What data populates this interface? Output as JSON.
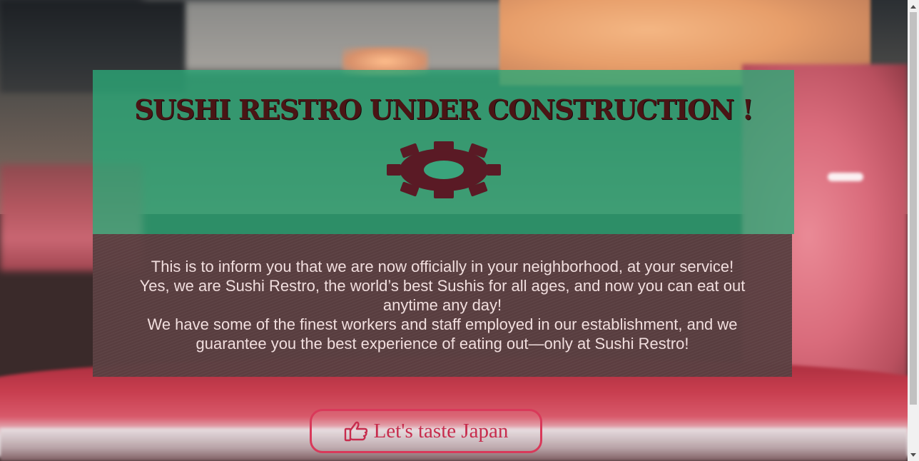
{
  "hero": {
    "title": "SUSHI RESTRO UNDER CONSTRUCTION !"
  },
  "info": {
    "paragraph_1": "This is to inform you that we are now officially in your neighborhood, at your service!",
    "paragraph_2": "Yes, we are Sushi Restro, the world’s best Sushis for all ages, and now you can eat out anytime any day!",
    "paragraph_3": "We have some of the finest workers and staff employed in our establishment, and we guarantee you the best experience of eating out—only at Sushi Restro!"
  },
  "cta": {
    "label": "Let's taste Japan",
    "icon": "thumbs-up-icon"
  },
  "icons": {
    "hero_icon": "gear-icon"
  },
  "colors": {
    "hero_bg": "#2aaa78",
    "title_color": "#4a1515",
    "gear_color": "#5a1a25",
    "info_bg": "#5a3e40",
    "info_text": "#f1dede",
    "cta_accent": "#d9395a"
  }
}
